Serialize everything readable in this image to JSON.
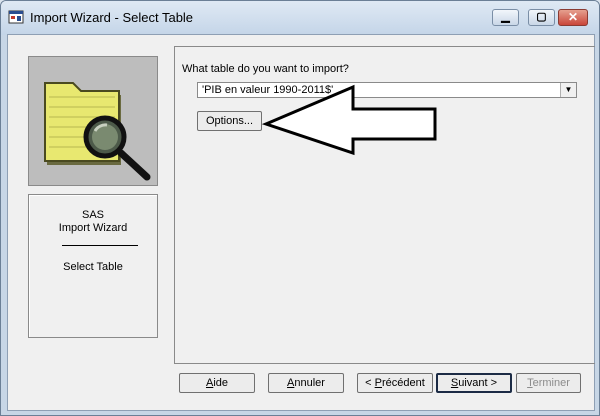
{
  "window": {
    "title": "Import Wizard - Select Table"
  },
  "sidebar": {
    "product": "SAS",
    "wizard_name": "Import Wizard",
    "step": "Select Table"
  },
  "main": {
    "question": "What table do you want to import?",
    "table_select": {
      "value": "'PIB en valeur 1990-2011$'"
    },
    "options_label": "Options..."
  },
  "footer": {
    "buttons": [
      {
        "label_pre": "",
        "mnemonic": "A",
        "label_post": "ide",
        "enabled": true
      },
      {
        "label_pre": "",
        "mnemonic": "A",
        "label_post": "nnuler",
        "enabled": true
      },
      {
        "label_pre": "< ",
        "mnemonic": "P",
        "label_post": "récédent",
        "enabled": true
      },
      {
        "label_pre": "",
        "mnemonic": "S",
        "label_post": "uivant >",
        "enabled": true,
        "default": true
      },
      {
        "label_pre": "",
        "mnemonic": "T",
        "label_post": "erminer",
        "enabled": false
      }
    ]
  },
  "colors": {
    "folder": "#e8e870",
    "frame": "#c7d6e6",
    "close": "#c9463a"
  }
}
